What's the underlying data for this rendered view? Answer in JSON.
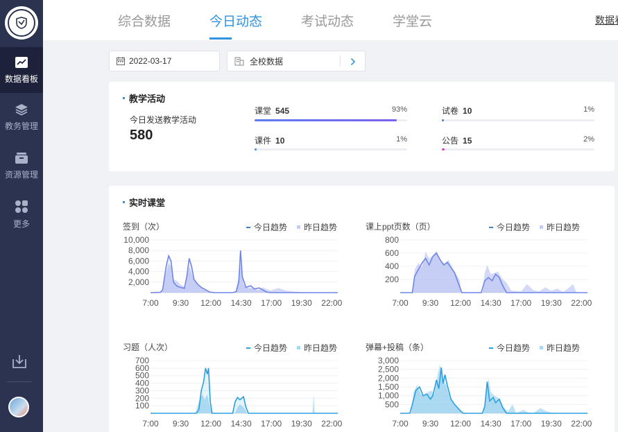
{
  "sidebar": {
    "items": [
      {
        "label": "数据看板",
        "icon": "trend-chart-icon",
        "active": true
      },
      {
        "label": "教务管理",
        "icon": "layers-icon",
        "active": false
      },
      {
        "label": "资源管理",
        "icon": "box-icon",
        "active": false
      },
      {
        "label": "更多",
        "icon": "grid-dots-icon",
        "active": false
      }
    ]
  },
  "header": {
    "tabs": [
      {
        "label": "综合数据",
        "active": false
      },
      {
        "label": "今日动态",
        "active": true
      },
      {
        "label": "考试动态",
        "active": false
      },
      {
        "label": "学堂云",
        "active": false
      }
    ],
    "right_link": "数据看板"
  },
  "filters": {
    "date": "2022-03-17",
    "scope": "全校数据"
  },
  "teaching": {
    "title": "教学活动",
    "total_label": "今日发送教学活动",
    "total_value": "580",
    "items": [
      {
        "name": "课堂",
        "value": "545",
        "pct": "93%",
        "fraction": 0.93,
        "color": "#7b61f0"
      },
      {
        "name": "试卷",
        "value": "10",
        "pct": "1%",
        "fraction": 0.01,
        "color": "#3b7fd6"
      },
      {
        "name": "课件",
        "value": "10",
        "pct": "1%",
        "fraction": 0.01,
        "color": "#2f93e0"
      },
      {
        "name": "公告",
        "value": "15",
        "pct": "2%",
        "fraction": 0.02,
        "color": "#e040c0"
      }
    ]
  },
  "realtime": {
    "title": "实时课堂",
    "legend_today": "今日趋势",
    "legend_yesterday": "昨日趋势",
    "xticks": [
      "7:00",
      "9:30",
      "12:00",
      "14:30",
      "17:00",
      "19:30",
      "22:00"
    ]
  },
  "chart_data": [
    {
      "type": "area",
      "title": "签到（次）",
      "yticks": [
        "10,000",
        "8,000",
        "6,000",
        "4,000",
        "2,000"
      ],
      "ylim": [
        0,
        10000
      ],
      "xrange": [
        7,
        22.5
      ],
      "colors": {
        "today": "#6f86e8",
        "yesterday": "#c5ccf4"
      },
      "series": [
        {
          "name": "今日趋势",
          "points": [
            [
              7,
              0
            ],
            [
              7.8,
              50
            ],
            [
              8.0,
              500
            ],
            [
              8.3,
              5000
            ],
            [
              8.5,
              7000
            ],
            [
              8.7,
              6000
            ],
            [
              8.9,
              2000
            ],
            [
              9.2,
              1200
            ],
            [
              9.5,
              1000
            ],
            [
              9.8,
              800
            ],
            [
              10.0,
              3000
            ],
            [
              10.2,
              6500
            ],
            [
              10.4,
              5000
            ],
            [
              10.6,
              2500
            ],
            [
              10.9,
              1600
            ],
            [
              11.2,
              1000
            ],
            [
              11.6,
              500
            ],
            [
              11.9,
              100
            ],
            [
              12.3,
              0
            ],
            [
              13.8,
              0
            ],
            [
              14.1,
              200
            ],
            [
              14.3,
              2000
            ],
            [
              14.45,
              8000
            ],
            [
              14.6,
              3000
            ],
            [
              14.9,
              1000
            ],
            [
              15.3,
              1300
            ],
            [
              15.6,
              700
            ],
            [
              16.0,
              900
            ],
            [
              16.3,
              500
            ],
            [
              16.6,
              100
            ],
            [
              17.0,
              0
            ],
            [
              22.5,
              0
            ]
          ]
        },
        {
          "name": "昨日趋势",
          "points": [
            [
              7,
              0
            ],
            [
              7.9,
              100
            ],
            [
              8.2,
              3000
            ],
            [
              8.5,
              5500
            ],
            [
              8.7,
              5000
            ],
            [
              8.9,
              2500
            ],
            [
              9.2,
              2200
            ],
            [
              9.5,
              1500
            ],
            [
              9.9,
              1000
            ],
            [
              10.2,
              5000
            ],
            [
              10.5,
              3000
            ],
            [
              10.9,
              1800
            ],
            [
              11.2,
              1000
            ],
            [
              11.8,
              200
            ],
            [
              12.2,
              0
            ],
            [
              14.0,
              0
            ],
            [
              14.3,
              3000
            ],
            [
              14.5,
              5500
            ],
            [
              14.7,
              1500
            ],
            [
              15.1,
              800
            ],
            [
              15.5,
              900
            ],
            [
              15.9,
              400
            ],
            [
              16.3,
              1000
            ],
            [
              16.9,
              400
            ],
            [
              17.6,
              900
            ],
            [
              18.2,
              400
            ],
            [
              19.0,
              200
            ],
            [
              19.6,
              100
            ],
            [
              22.5,
              0
            ]
          ]
        }
      ]
    },
    {
      "type": "area",
      "title": "课上ppt页数（页）",
      "yticks": [
        "800",
        "600",
        "400",
        "200"
      ],
      "ylim": [
        0,
        800
      ],
      "xrange": [
        7,
        22.5
      ],
      "colors": {
        "today": "#6f86e8",
        "yesterday": "#c5ccf4"
      },
      "series": [
        {
          "name": "今日趋势",
          "points": [
            [
              7,
              0
            ],
            [
              8.0,
              0
            ],
            [
              8.2,
              250
            ],
            [
              8.5,
              350
            ],
            [
              8.8,
              450
            ],
            [
              9.1,
              520
            ],
            [
              9.4,
              420
            ],
            [
              9.7,
              550
            ],
            [
              10.0,
              600
            ],
            [
              10.3,
              500
            ],
            [
              10.6,
              420
            ],
            [
              10.9,
              460
            ],
            [
              11.2,
              380
            ],
            [
              11.5,
              300
            ],
            [
              11.8,
              150
            ],
            [
              12.1,
              0
            ],
            [
              13.7,
              0
            ],
            [
              14.0,
              180
            ],
            [
              14.3,
              230
            ],
            [
              14.6,
              180
            ],
            [
              14.9,
              280
            ],
            [
              15.2,
              230
            ],
            [
              15.5,
              100
            ],
            [
              15.8,
              0
            ],
            [
              22.5,
              0
            ]
          ]
        },
        {
          "name": "昨日趋势",
          "points": [
            [
              7,
              0
            ],
            [
              8.0,
              0
            ],
            [
              8.2,
              350
            ],
            [
              8.5,
              450
            ],
            [
              8.8,
              380
            ],
            [
              9.1,
              620
            ],
            [
              9.4,
              520
            ],
            [
              9.7,
              560
            ],
            [
              10.0,
              640
            ],
            [
              10.3,
              480
            ],
            [
              10.7,
              440
            ],
            [
              11.0,
              500
            ],
            [
              11.4,
              350
            ],
            [
              11.9,
              200
            ],
            [
              12.1,
              0
            ],
            [
              13.8,
              0
            ],
            [
              14.0,
              300
            ],
            [
              14.2,
              420
            ],
            [
              14.5,
              280
            ],
            [
              14.8,
              300
            ],
            [
              15.1,
              320
            ],
            [
              15.4,
              220
            ],
            [
              15.8,
              150
            ],
            [
              16.2,
              30
            ],
            [
              17.0,
              20
            ],
            [
              17.5,
              130
            ],
            [
              18.0,
              40
            ],
            [
              18.5,
              20
            ],
            [
              19.0,
              80
            ],
            [
              19.5,
              30
            ],
            [
              20.0,
              60
            ],
            [
              20.5,
              10
            ],
            [
              21.0,
              80
            ],
            [
              21.3,
              130
            ],
            [
              21.6,
              0
            ],
            [
              22.5,
              0
            ]
          ]
        }
      ]
    },
    {
      "type": "area",
      "title": "习题（人次）",
      "yticks": [
        "700",
        "600",
        "500",
        "400",
        "300",
        "200",
        "100"
      ],
      "ylim": [
        0,
        700
      ],
      "xrange": [
        7,
        22.5
      ],
      "colors": {
        "today": "#2aa0e0",
        "yesterday": "#a8d8f2"
      },
      "series": [
        {
          "name": "今日趋势",
          "points": [
            [
              7,
              0
            ],
            [
              10.8,
              0
            ],
            [
              11.0,
              50
            ],
            [
              11.2,
              300
            ],
            [
              11.4,
              420
            ],
            [
              11.55,
              600
            ],
            [
              11.7,
              520
            ],
            [
              11.8,
              600
            ],
            [
              11.95,
              150
            ],
            [
              12.1,
              0
            ],
            [
              13.8,
              0
            ],
            [
              14.0,
              150
            ],
            [
              14.2,
              210
            ],
            [
              14.4,
              180
            ],
            [
              14.7,
              220
            ],
            [
              14.9,
              80
            ],
            [
              15.1,
              0
            ],
            [
              22.5,
              0
            ]
          ]
        },
        {
          "name": "昨日趋势",
          "points": [
            [
              7,
              0
            ],
            [
              10.7,
              0
            ],
            [
              10.9,
              100
            ],
            [
              11.1,
              200
            ],
            [
              11.3,
              250
            ],
            [
              11.5,
              180
            ],
            [
              11.7,
              250
            ],
            [
              11.9,
              100
            ],
            [
              12.1,
              0
            ],
            [
              14.0,
              0
            ],
            [
              14.2,
              80
            ],
            [
              14.4,
              120
            ],
            [
              14.7,
              80
            ],
            [
              15.0,
              0
            ],
            [
              20.4,
              0
            ],
            [
              20.5,
              250
            ],
            [
              20.6,
              0
            ],
            [
              22.5,
              0
            ]
          ]
        }
      ]
    },
    {
      "type": "area",
      "title": "弹幕+投稿（条）",
      "yticks": [
        "3,000",
        "2,500",
        "2,000",
        "1,500",
        "1,000",
        "500"
      ],
      "ylim": [
        0,
        3000
      ],
      "xrange": [
        7,
        22.5
      ],
      "colors": {
        "today": "#2aa0e0",
        "yesterday": "#a8d8f2"
      },
      "series": [
        {
          "name": "今日趋势",
          "points": [
            [
              7,
              0
            ],
            [
              7.8,
              0
            ],
            [
              8.0,
              500
            ],
            [
              8.3,
              1300
            ],
            [
              8.6,
              1500
            ],
            [
              8.9,
              1000
            ],
            [
              9.2,
              1100
            ],
            [
              9.5,
              800
            ],
            [
              9.7,
              1000
            ],
            [
              10.0,
              1900
            ],
            [
              10.2,
              1400
            ],
            [
              10.4,
              2600
            ],
            [
              10.55,
              1700
            ],
            [
              10.7,
              2200
            ],
            [
              10.9,
              1600
            ],
            [
              11.2,
              800
            ],
            [
              11.5,
              500
            ],
            [
              11.9,
              200
            ],
            [
              12.2,
              0
            ],
            [
              13.8,
              0
            ],
            [
              14.0,
              400
            ],
            [
              14.2,
              1800
            ],
            [
              14.4,
              700
            ],
            [
              14.7,
              900
            ],
            [
              14.9,
              600
            ],
            [
              15.2,
              800
            ],
            [
              15.5,
              300
            ],
            [
              15.8,
              0
            ],
            [
              22.5,
              0
            ]
          ]
        },
        {
          "name": "昨日趋势",
          "points": [
            [
              7,
              0
            ],
            [
              7.9,
              0
            ],
            [
              8.1,
              1200
            ],
            [
              8.4,
              1600
            ],
            [
              8.7,
              1100
            ],
            [
              9.0,
              1000
            ],
            [
              9.3,
              1200
            ],
            [
              9.6,
              1300
            ],
            [
              9.8,
              1000
            ],
            [
              10.1,
              2200
            ],
            [
              10.3,
              2800
            ],
            [
              10.5,
              1900
            ],
            [
              10.8,
              1600
            ],
            [
              11.1,
              900
            ],
            [
              11.4,
              600
            ],
            [
              11.8,
              300
            ],
            [
              12.2,
              0
            ],
            [
              13.9,
              0
            ],
            [
              14.1,
              1000
            ],
            [
              14.3,
              2000
            ],
            [
              14.5,
              1200
            ],
            [
              14.8,
              1000
            ],
            [
              15.1,
              900
            ],
            [
              15.5,
              400
            ],
            [
              15.9,
              100
            ],
            [
              16.3,
              500
            ],
            [
              16.6,
              0
            ],
            [
              17.2,
              200
            ],
            [
              17.6,
              50
            ],
            [
              18.0,
              0
            ],
            [
              18.6,
              300
            ],
            [
              19.0,
              150
            ],
            [
              19.6,
              0
            ],
            [
              22.5,
              0
            ]
          ]
        }
      ]
    }
  ]
}
